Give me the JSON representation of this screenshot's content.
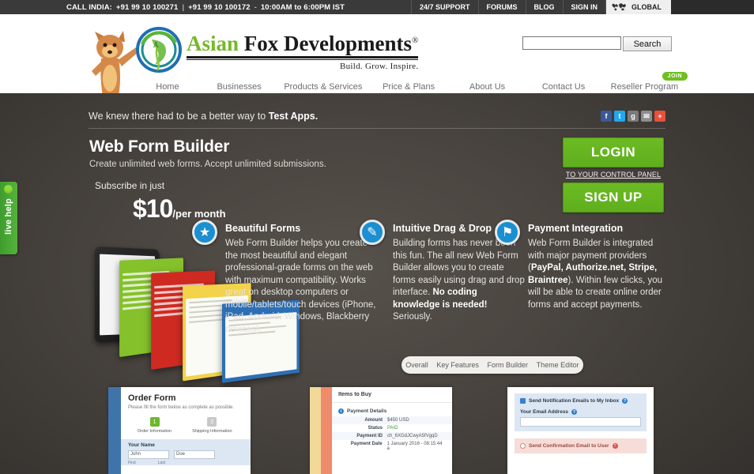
{
  "topbar": {
    "call_label": "CALL INDIA:",
    "phone1": "+91 99 10 100271",
    "separator": "|",
    "phone2": "+91 99 10 100172",
    "dash": "-",
    "hours": "10:00AM to 6:00PM IST",
    "links": [
      {
        "label": "24/7 SUPPORT"
      },
      {
        "label": "FORUMS"
      },
      {
        "label": "BLOG"
      },
      {
        "label": "SIGN IN"
      }
    ],
    "global_label": "GLOBAL",
    "globe_icon": "globe-icon"
  },
  "header": {
    "brand_asian": "Asian",
    "brand_fox": "Fox",
    "brand_dev": "Developments",
    "brand_reg": "®",
    "brand_tagline": "Build. Grow. Inspire.",
    "mascot_icon": "fox-mascot-icon",
    "logo_icon": "asian-fox-logo-icon",
    "search": {
      "value": "",
      "placeholder": "",
      "button_label": "Search",
      "icon": "search-icon"
    },
    "nav": [
      {
        "label": "Home",
        "caret": false
      },
      {
        "label": "Businesses",
        "caret": false
      },
      {
        "label": "Products & Services",
        "caret": true
      },
      {
        "label": "Price & Plans",
        "caret": true
      },
      {
        "label": "About Us",
        "caret": false
      },
      {
        "label": "Contact Us",
        "caret": true
      },
      {
        "label": "Reseller Program",
        "caret": false,
        "badge": "JOIN"
      }
    ]
  },
  "banner": {
    "tagline_prefix": "We knew there had to be a better way to",
    "tagline_strong": "Test Apps.",
    "social": [
      {
        "name": "facebook-icon",
        "glyph": "f"
      },
      {
        "name": "twitter-icon",
        "glyph": "t"
      },
      {
        "name": "google-plus-icon",
        "glyph": "g"
      },
      {
        "name": "email-icon",
        "glyph": "✉"
      },
      {
        "name": "share-more-icon",
        "glyph": "+"
      }
    ]
  },
  "live_help": {
    "label": "live help",
    "icon": "live-help-dot-icon"
  },
  "hero": {
    "title": "Web Form Builder",
    "subtitle": "Create unlimited web forms. Accept unlimited submissions.",
    "subscribe_label": "Subscribe in just",
    "price_amount": "$10",
    "price_period": "/per month",
    "login_label": "LOGIN",
    "control_panel_link": "TO YOUR CONTROL PANEL",
    "signup_label": "SIGN UP",
    "artwork_icon": "forms-devices-artwork"
  },
  "features": [
    {
      "icon": "star-badge-icon",
      "glyph": "★",
      "title": "Beautiful Forms",
      "body": "Web Form Builder helps you create the most beautiful and elegant professional-grade forms on the web with maximum compatibility. Works great on desktop computers or mobile/tablets/touch devices (iPhone, iPad, Android, Windows, Blackberry devices)."
    },
    {
      "icon": "pencil-icon",
      "glyph": "✎",
      "title": "Intuitive Drag & Drop",
      "body_pre": "Building forms has never been this fun. The all new Web Form Builder allows you to create forms easily using drag and drop interface. ",
      "body_strong": "No coding knowledge is needed!",
      "body_post": " Seriously."
    },
    {
      "icon": "price-tag-icon",
      "glyph": "⚑",
      "title": "Payment Integration",
      "body_pre": "Web Form Builder is integrated with major payment providers (",
      "body_strong": "PayPal, Authorize.net, Stripe, Braintree",
      "body_post": "). Within few clicks, you will be able to create online order forms and accept payments."
    }
  ],
  "tabs": [
    {
      "label": "Overall",
      "active": true
    },
    {
      "label": "Key Features",
      "active": false
    },
    {
      "label": "Form Builder",
      "active": false
    },
    {
      "label": "Theme Editor",
      "active": false
    }
  ],
  "shots": {
    "order_form": {
      "title": "Order Form",
      "description": "Please fill the form below as complete as possible.",
      "steps": [
        {
          "number": "1",
          "label": "Order Information",
          "active": true
        },
        {
          "number": "2",
          "label": "Shipping Information",
          "active": false
        }
      ],
      "field_label": "Your Name",
      "first_value": "John",
      "last_value": "Doe",
      "first_sub": "First",
      "last_sub": "Last"
    },
    "payment": {
      "header": "Items to Buy",
      "section": "Payment Details",
      "rows": [
        {
          "key": "Amount",
          "value": "$450 USD"
        },
        {
          "key": "Status",
          "value": "PAID",
          "paid": true
        },
        {
          "key": "Payment ID",
          "value": "ch_6XGdJCwyA5fVgqD"
        },
        {
          "key": "Payment Date",
          "value": "1 January 2016 - 08:15:44 a"
        }
      ]
    },
    "notifications": {
      "checkbox_label": "Send Notification Emails to My Inbox",
      "email_label": "Your Email Address",
      "email_value": "",
      "confirm_label": "Send Confirmation Email to User"
    }
  },
  "colors": {
    "accent_green": "#6cbb23",
    "brand_green": "#76b82a",
    "icon_blue": "#1a8fd1",
    "dark_bg": "#4a4540",
    "topbar_bg": "#3a3a3a"
  }
}
